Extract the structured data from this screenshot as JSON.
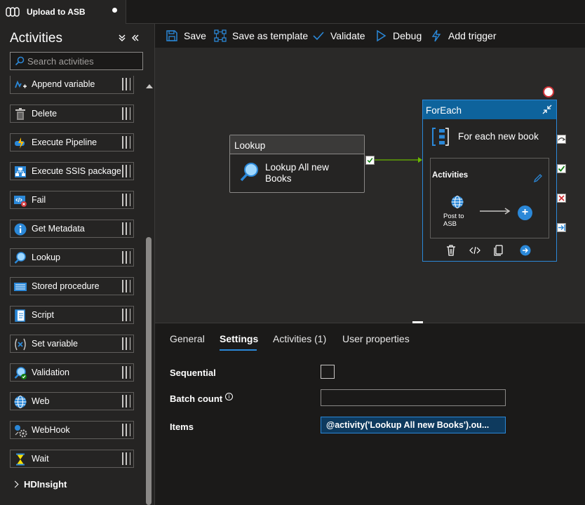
{
  "tab": {
    "title": "Upload to ASB",
    "unsaved": true
  },
  "sidebar": {
    "title": "Activities",
    "search_placeholder": "Search activities",
    "activities": [
      {
        "label": "Append variable",
        "icon": "append-variable-icon"
      },
      {
        "label": "Delete",
        "icon": "delete-icon"
      },
      {
        "label": "Execute Pipeline",
        "icon": "execute-pipeline-icon"
      },
      {
        "label": "Execute SSIS package",
        "icon": "ssis-package-icon"
      },
      {
        "label": "Fail",
        "icon": "fail-icon"
      },
      {
        "label": "Get Metadata",
        "icon": "info-icon"
      },
      {
        "label": "Lookup",
        "icon": "lookup-icon"
      },
      {
        "label": "Stored procedure",
        "icon": "stored-procedure-icon"
      },
      {
        "label": "Script",
        "icon": "script-icon"
      },
      {
        "label": "Set variable",
        "icon": "set-variable-icon"
      },
      {
        "label": "Validation",
        "icon": "validation-icon"
      },
      {
        "label": "Web",
        "icon": "globe-icon"
      },
      {
        "label": "WebHook",
        "icon": "webhook-icon"
      },
      {
        "label": "Wait",
        "icon": "hourglass-icon"
      }
    ],
    "group": "HDInsight"
  },
  "toolbar": {
    "save": "Save",
    "save_template": "Save as template",
    "validate": "Validate",
    "debug": "Debug",
    "add_trigger": "Add trigger"
  },
  "canvas": {
    "lookup": {
      "type": "Lookup",
      "name": "Lookup All new Books"
    },
    "foreach": {
      "type": "ForEach",
      "name": "For each new book",
      "inner_title": "Activities",
      "inner_activity": "Post to ASB"
    }
  },
  "panel": {
    "tabs": [
      "General",
      "Settings",
      "Activities (1)",
      "User properties"
    ],
    "active_tab": "Settings",
    "sequential_label": "Sequential",
    "batch_count_label": "Batch count",
    "batch_count_value": "",
    "items_label": "Items",
    "items_value": "@activity('Lookup All new Books').ou..."
  },
  "colors": {
    "accent": "#2b88d8",
    "foreach_header": "#0e639c",
    "success": "#107c10",
    "error": "#d13438"
  }
}
